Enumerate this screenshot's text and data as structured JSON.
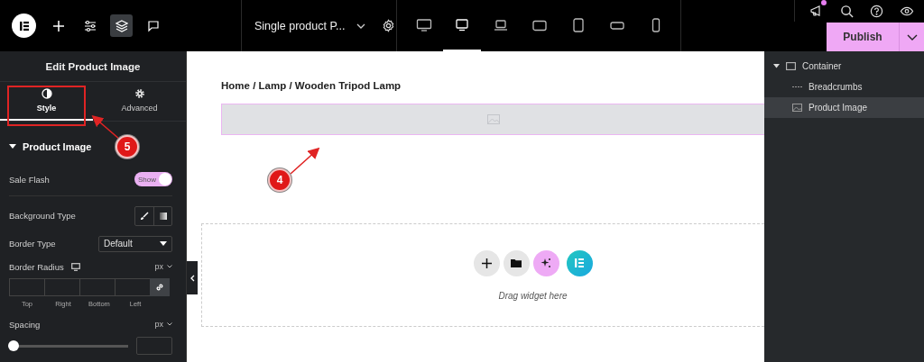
{
  "topbar": {
    "tools": [
      {
        "selected": false
      },
      {
        "selected": false
      },
      {
        "selected": true
      },
      {
        "selected": false
      }
    ],
    "document_title": "Single product P...",
    "devices": [
      {
        "selected": false
      },
      {
        "selected": true
      },
      {
        "selected": false
      },
      {
        "selected": false
      },
      {
        "selected": false
      },
      {
        "selected": false
      },
      {
        "selected": false
      }
    ],
    "notification": true,
    "publish": "Publish"
  },
  "panel": {
    "title": "Edit Product Image",
    "tabs": [
      {
        "label": "Style",
        "selected": true
      },
      {
        "label": "Advanced",
        "selected": false
      }
    ],
    "section": {
      "title": "Product Image",
      "expanded": true
    },
    "controls": [
      {
        "kind": "toggle",
        "label": "Sale Flash",
        "on": true,
        "value": "Show"
      },
      {
        "kind": "choice",
        "label": "Background Type"
      },
      {
        "kind": "select",
        "label": "Border Type",
        "value": "Default"
      },
      {
        "kind": "dimensions",
        "label": "Border Radius",
        "unit": "px",
        "fields": [
          "Top",
          "Right",
          "Bottom",
          "Left"
        ]
      },
      {
        "kind": "slider",
        "label": "Spacing",
        "unit": "px",
        "level": 0
      }
    ]
  },
  "canvas": {
    "breadcrumb": "Home / Lamp / Wooden Tripod Lamp",
    "drop_hint": "Drag widget here"
  },
  "navigator": [
    {
      "label": "Container",
      "expanded": true,
      "selected": false,
      "children": [
        {
          "label": "Breadcrumbs",
          "selected": false
        },
        {
          "label": "Product Image",
          "selected": true
        }
      ]
    }
  ],
  "annotations": [
    {
      "label": "5"
    },
    {
      "label": "4"
    }
  ]
}
